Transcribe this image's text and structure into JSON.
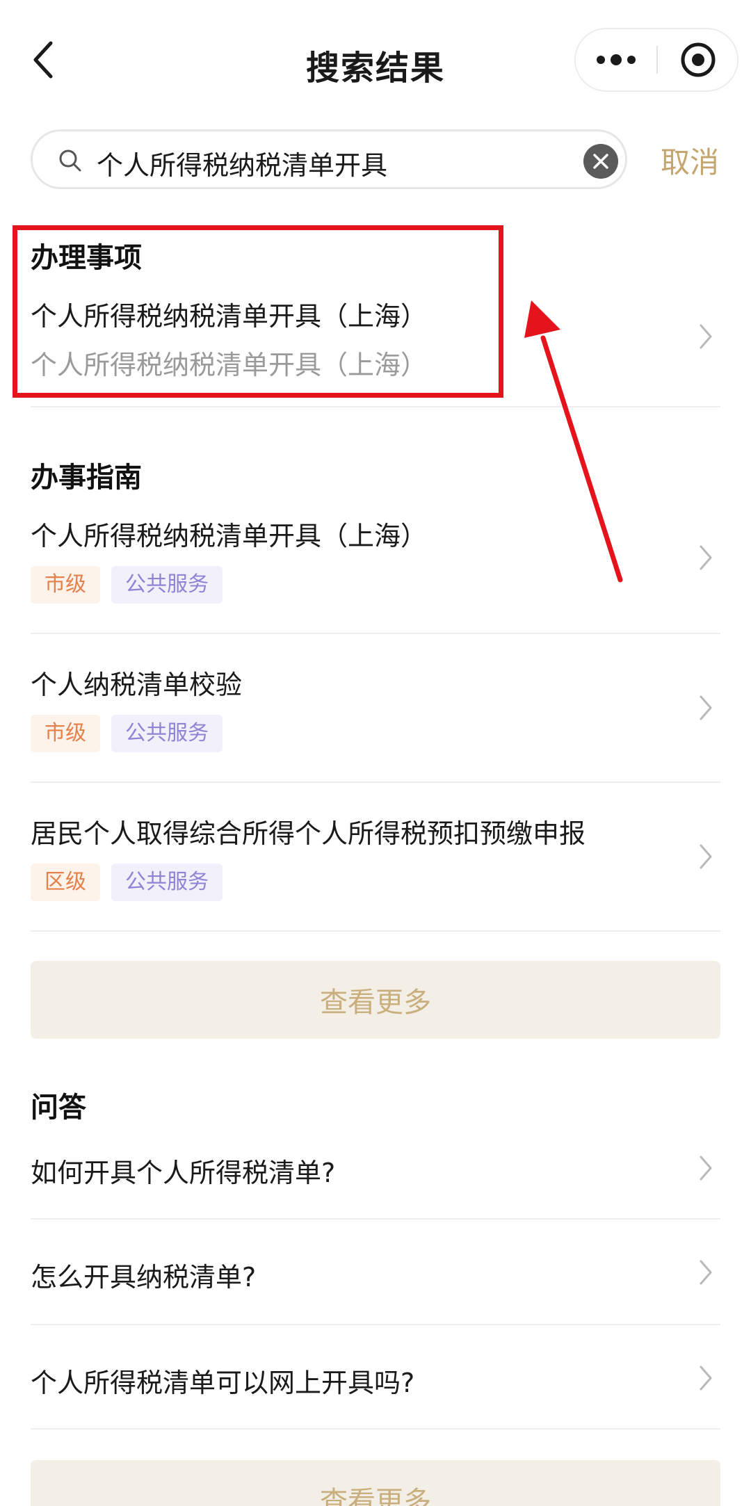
{
  "nav": {
    "title": "搜索结果",
    "back_icon": "chevron-left-icon",
    "more_icon": "more-dots-icon",
    "target_icon": "target-circle-icon"
  },
  "search": {
    "value": "个人所得税纳税清单开具",
    "cancel_label": "取消"
  },
  "sections": {
    "items": {
      "title": "办理事项",
      "entries": [
        {
          "title": "个人所得税纳税清单开具（上海）",
          "subtitle": "个人所得税纳税清单开具（上海）"
        }
      ]
    },
    "guides": {
      "title": "办事指南",
      "entries": [
        {
          "title": "个人所得税纳税清单开具（上海）",
          "tags": [
            "市级",
            "公共服务"
          ]
        },
        {
          "title": "个人纳税清单校验",
          "tags": [
            "市级",
            "公共服务"
          ]
        },
        {
          "title": "居民个人取得综合所得个人所得税预扣预缴申报",
          "tags": [
            "区级",
            "公共服务"
          ]
        }
      ],
      "more_label": "查看更多"
    },
    "qa": {
      "title": "问答",
      "entries": [
        {
          "title": "如何开具个人所得税清单?"
        },
        {
          "title": "怎么开具纳税清单?"
        },
        {
          "title": "个人所得税清单可以网上开具吗?"
        }
      ],
      "more_label": "查看更多"
    }
  },
  "colors": {
    "accent": "#c4a66e",
    "annotation": "#e4131c",
    "tag_level": "#e5804a",
    "tag_public": "#8e84d6"
  }
}
